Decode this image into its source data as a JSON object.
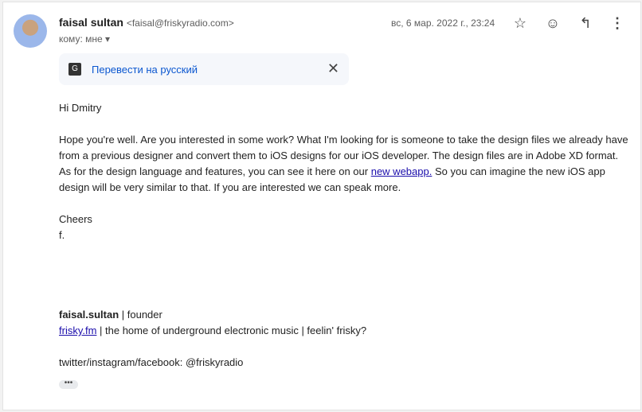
{
  "sender": {
    "name": "faisal sultan",
    "email": "<faisal@friskyradio.com>",
    "to": "кому: мне"
  },
  "date": "вс, 6 мар. 2022 г., 23:24",
  "icons": [
    "star-icon",
    "emoji-icon",
    "reply-icon",
    "more-vert-icon"
  ],
  "translate": {
    "label": "Перевести на русский"
  },
  "body": {
    "greeting": "Hi Dmitry",
    "p1_before": "Hope you're well.  Are you interested in some work?  What I'm looking for is someone to take the design files we already have from a previous designer and convert them to iOS designs for our iOS developer.  The design files are in Adobe XD format.  As for the design language and features, you can see it here on our ",
    "p1_link": "new webapp.",
    "p1_after": " So you can imagine the new iOS app design will be very similar to that.  If you are interested we can speak more.",
    "closing": "Cheers",
    "initial": "f.",
    "sig_name": "faisal.sultan",
    "sig_role": " | founder",
    "sig_link": "frisky.fm",
    "sig_tagline": " | the home of underground electronic music | feelin' frisky?",
    "social": "twitter/instagram/facebook: @friskyradio",
    "more": "•••"
  }
}
